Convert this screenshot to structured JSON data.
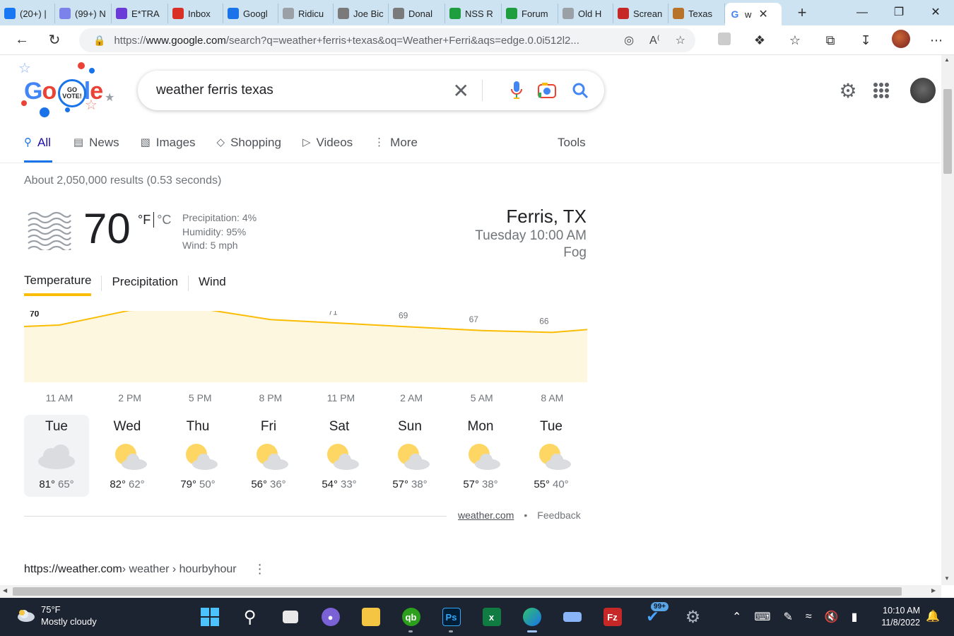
{
  "browser": {
    "tabs": [
      {
        "label": "(20+) |",
        "icon_color": "#1877f2",
        "icon": "facebook-icon"
      },
      {
        "label": "(99+) N",
        "icon_color": "#7b83eb",
        "icon": "dots-icon"
      },
      {
        "label": "E*TRA",
        "icon_color": "#6a3bd6",
        "icon": "etrade-icon"
      },
      {
        "label": "Inbox",
        "icon_color": "#d93025",
        "icon": "gmail-icon"
      },
      {
        "label": "Googl",
        "icon_color": "#1a73e8",
        "icon": "google-calendar-icon"
      },
      {
        "label": "Ridicu",
        "icon_color": "#9aa0a6",
        "icon": "page-icon"
      },
      {
        "label": "Joe Bic",
        "icon_color": "#7a7a7a",
        "icon": "page-icon"
      },
      {
        "label": "Donal",
        "icon_color": "#7a7a7a",
        "icon": "page-icon"
      },
      {
        "label": "NSS R",
        "icon_color": "#1e9e3e",
        "icon": "nss-icon"
      },
      {
        "label": "Forum",
        "icon_color": "#1e9e3e",
        "icon": "forum-icon"
      },
      {
        "label": "Old H",
        "icon_color": "#9aa0a6",
        "icon": "page-icon"
      },
      {
        "label": "Screan",
        "icon_color": "#c62828",
        "icon": "page-icon"
      },
      {
        "label": "Texas",
        "icon_color": "#b8732a",
        "icon": "page-icon"
      },
      {
        "label": "w",
        "icon_color": "#ffffff",
        "icon": "google-icon",
        "active": true
      }
    ],
    "url_prefix": "https://",
    "url_host": "www.google.com",
    "url_rest": "/search?q=weather+ferris+texas&oq=Weather+Ferri&aqs=edge.0.0i512l2..."
  },
  "google": {
    "logo_text": "Google",
    "logo_badge": "GO VOTE!",
    "query": "weather ferris texas",
    "tabs": [
      {
        "label": "All",
        "icon": "search-icon",
        "active": true
      },
      {
        "label": "News",
        "icon": "news-icon"
      },
      {
        "label": "Images",
        "icon": "images-icon"
      },
      {
        "label": "Shopping",
        "icon": "shopping-icon"
      },
      {
        "label": "Videos",
        "icon": "videos-icon"
      },
      {
        "label": "More",
        "icon": "more-icon"
      }
    ],
    "tools": "Tools",
    "stats": "About 2,050,000 results (0.53 seconds)"
  },
  "weather": {
    "temp": "70",
    "unit_f": "°F",
    "unit_c": "°C",
    "precipitation": "Precipitation: 4%",
    "humidity": "Humidity: 95%",
    "wind": "Wind: 5 mph",
    "location": "Ferris, TX",
    "datetime": "Tuesday 10:00 AM",
    "condition": "Fog",
    "tabs": [
      "Temperature",
      "Precipitation",
      "Wind"
    ],
    "source": "weather.com",
    "feedback": "Feedback",
    "footer_sep": "•",
    "days": [
      {
        "name": "Tue",
        "hi": "81°",
        "lo": "65°",
        "icon": "cloudy"
      },
      {
        "name": "Wed",
        "hi": "82°",
        "lo": "62°",
        "icon": "partly-cloudy"
      },
      {
        "name": "Thu",
        "hi": "79°",
        "lo": "50°",
        "icon": "partly-cloudy"
      },
      {
        "name": "Fri",
        "hi": "56°",
        "lo": "36°",
        "icon": "partly-cloudy"
      },
      {
        "name": "Sat",
        "hi": "54°",
        "lo": "33°",
        "icon": "partly-cloudy"
      },
      {
        "name": "Sun",
        "hi": "57°",
        "lo": "38°",
        "icon": "partly-cloudy"
      },
      {
        "name": "Mon",
        "hi": "57°",
        "lo": "38°",
        "icon": "partly-cloudy"
      },
      {
        "name": "Tue",
        "hi": "55°",
        "lo": "40°",
        "icon": "partly-cloudy"
      }
    ]
  },
  "chart_data": {
    "type": "area",
    "categories": [
      "11 AM",
      "2 PM",
      "5 PM",
      "8 PM",
      "11 PM",
      "2 AM",
      "5 AM",
      "8 AM"
    ],
    "series": [
      {
        "values": [
          70,
          78,
          79,
          73,
          71,
          69,
          67,
          66
        ]
      }
    ],
    "color": "#fbbc04"
  },
  "result": {
    "url": "https://weather.com",
    "crumb": " › weather › hourbyhour",
    "kebab": "⋮"
  },
  "taskbar": {
    "weather_temp": "75°F",
    "weather_desc": "Mostly cloudy",
    "notif_count": "99+",
    "time": "10:10 AM",
    "date": "11/8/2022"
  }
}
